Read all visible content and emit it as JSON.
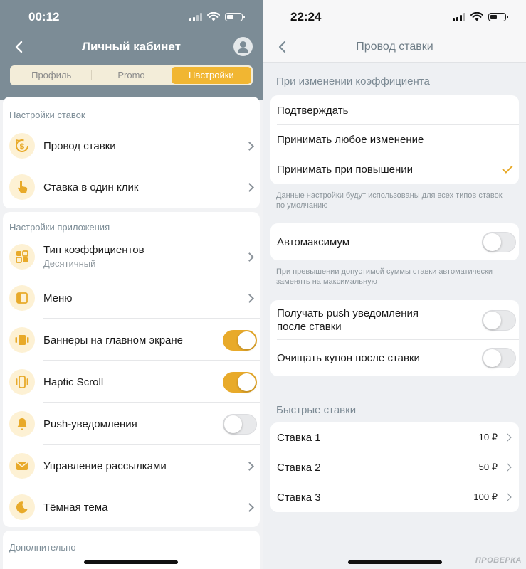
{
  "left": {
    "status": {
      "time": "00:12"
    },
    "header": {
      "title": "Личный кабинет"
    },
    "segments": [
      {
        "label": "Профиль",
        "active": false
      },
      {
        "label": "Promo",
        "active": false
      },
      {
        "label": "Настройки",
        "active": true
      }
    ],
    "bet_settings": {
      "title": "Настройки ставок",
      "items": [
        {
          "label": "Провод ставки",
          "icon": "bet-confirm-icon"
        },
        {
          "label": "Ставка в один клик",
          "icon": "tap-finger-icon"
        }
      ]
    },
    "app_settings": {
      "title": "Настройки приложения",
      "items": [
        {
          "label": "Тип коэффициентов",
          "sub": "Десятичный",
          "icon": "grid-icon",
          "control": "chevron"
        },
        {
          "label": "Меню",
          "icon": "menu-panel-icon",
          "control": "chevron"
        },
        {
          "label": "Баннеры на главном экране",
          "icon": "banners-icon",
          "control": "toggle",
          "on": true
        },
        {
          "label": "Haptic Scroll",
          "icon": "vibration-icon",
          "control": "toggle",
          "on": true
        },
        {
          "label": "Push-уведомления",
          "icon": "bell-icon",
          "control": "toggle",
          "on": false
        },
        {
          "label": "Управление рассылками",
          "icon": "mail-icon",
          "control": "chevron"
        },
        {
          "label": "Тёмная тема",
          "icon": "moon-icon",
          "control": "chevron"
        }
      ]
    },
    "extra": {
      "title": "Дополнительно"
    }
  },
  "right": {
    "status": {
      "time": "22:24"
    },
    "header": {
      "title": "Провод ставки"
    },
    "odds_change": {
      "title": "При изменении коэффициента",
      "options": [
        {
          "label": "Подтверждать",
          "selected": false
        },
        {
          "label": "Принимать любое изменение",
          "selected": false
        },
        {
          "label": "Принимать при повышении",
          "selected": true
        }
      ],
      "hint": "Данные настройки будут использованы для всех типов ставок по умолчанию"
    },
    "automax": {
      "label": "Автомаксимум",
      "on": false,
      "hint": "При превышении допустимой суммы ставки автоматически заменять на максимальную"
    },
    "after_bet": [
      {
        "label": "Получать push уведомления после ставки",
        "on": false
      },
      {
        "label": "Очищать купон после ставки",
        "on": false
      }
    ],
    "quick_bets": {
      "title": "Быстрые ставки",
      "items": [
        {
          "label": "Ставка 1",
          "value": "10 ₽"
        },
        {
          "label": "Ставка 2",
          "value": "50 ₽"
        },
        {
          "label": "Ставка 3",
          "value": "100 ₽"
        }
      ]
    }
  },
  "watermark": "ПРОВЕРКА",
  "colors": {
    "accent": "#f1b632",
    "toggle_on": "#e8aa2a",
    "header_bg": "#7c8c96",
    "icon_bg": "#fdf1d4"
  }
}
